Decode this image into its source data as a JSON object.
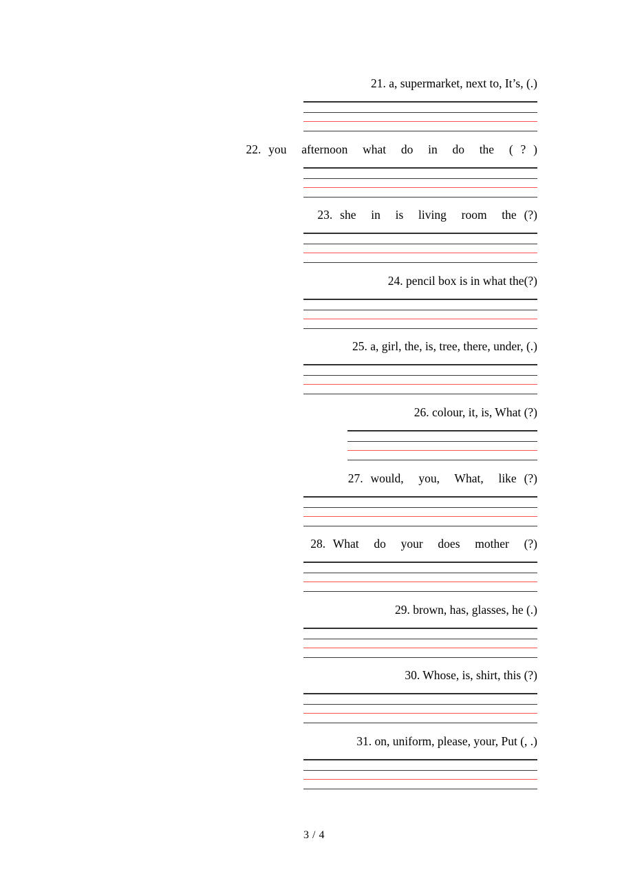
{
  "document": {
    "page_label": "3 / 4",
    "line_colors": {
      "black": "#3a3a3a",
      "red": "#fc5050"
    }
  },
  "questions": [
    {
      "number": "21.",
      "text": "21. a, supermarket, next to, It’s, (.)",
      "spacing": "normal",
      "indented_rules": false
    },
    {
      "number": "22.",
      "text": "22. you  afternoon  what  do  in  do  the  ( ? )",
      "spacing": "wide",
      "indented_rules": false
    },
    {
      "number": "23.",
      "text": "23. she  in  is  living  room  the (?)",
      "spacing": "wide",
      "indented_rules": false
    },
    {
      "number": "24.",
      "text": "24. pencil box is in what the(?)",
      "spacing": "normal",
      "indented_rules": false
    },
    {
      "number": "25.",
      "text": "25. a, girl, the, is, tree, there, under, (.)",
      "spacing": "normal",
      "indented_rules": false
    },
    {
      "number": "26.",
      "text": "26. colour, it, is, What (?)",
      "spacing": "normal",
      "indented_rules": true
    },
    {
      "number": "27.",
      "text": "27. would,  you,  What,  like (?)",
      "spacing": "wide",
      "indented_rules": false
    },
    {
      "number": "28.",
      "text": "28. What  do  your  does  mother  (?)",
      "spacing": "wide",
      "indented_rules": false
    },
    {
      "number": "29.",
      "text": "29. brown, has, glasses, he (.)",
      "spacing": "normal",
      "indented_rules": false
    },
    {
      "number": "30.",
      "text": "30. Whose, is, shirt, this (?)",
      "spacing": "normal",
      "indented_rules": false
    },
    {
      "number": "31.",
      "text": "31. on, uniform, please, your, Put (, .)",
      "spacing": "normal",
      "indented_rules": false
    }
  ]
}
